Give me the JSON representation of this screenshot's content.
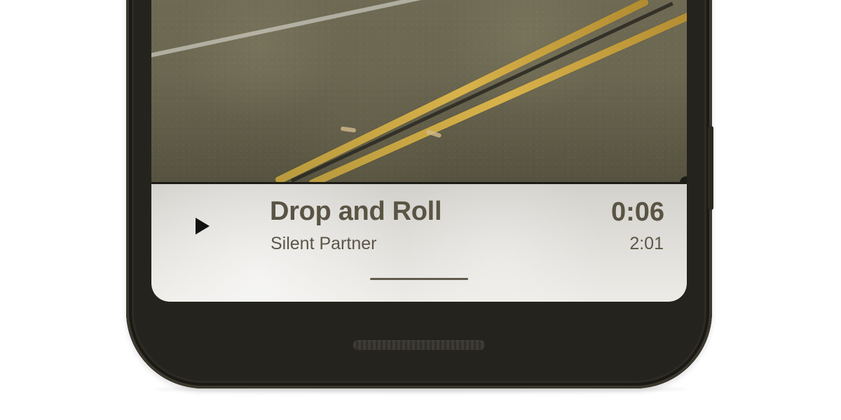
{
  "player": {
    "title": "Drop and Roll",
    "artist": "Silent Partner",
    "elapsed": "0:06",
    "duration": "2:01"
  },
  "icons": {
    "play": "play-icon"
  },
  "colors": {
    "phone_body": "#25231d",
    "player_text": "#5a5444",
    "player_subtext": "#5c5647",
    "road_line": "#d8b24a"
  }
}
